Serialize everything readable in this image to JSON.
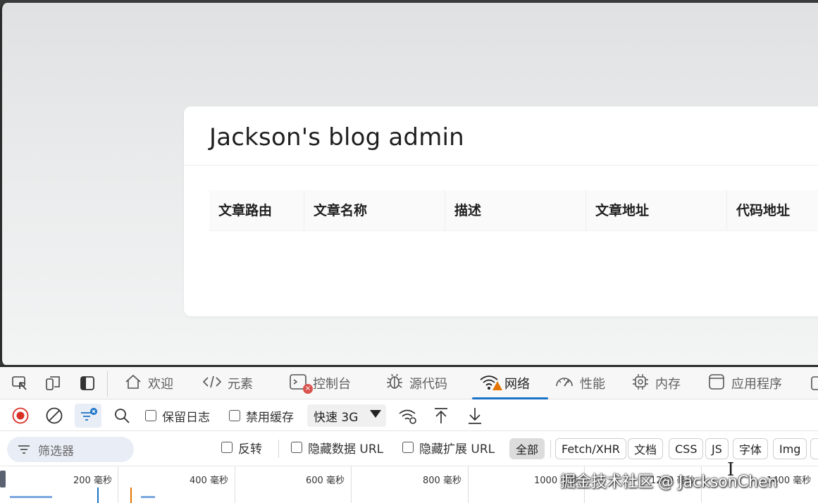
{
  "page": {
    "title": "Jackson's blog admin",
    "table_headers": [
      "文章路由",
      "文章名称",
      "描述",
      "文章地址",
      "代码地址"
    ]
  },
  "devtools": {
    "tabs": [
      {
        "label": "欢迎",
        "icon": "home-icon"
      },
      {
        "label": "元素",
        "icon": "code-icon"
      },
      {
        "label": "控制台",
        "icon": "console-icon"
      },
      {
        "label": "源代码",
        "icon": "bug-icon"
      },
      {
        "label": "网络",
        "icon": "wifi-warning-icon",
        "active": true
      },
      {
        "label": "性能",
        "icon": "gauge-icon"
      },
      {
        "label": "内存",
        "icon": "chip-icon"
      },
      {
        "label": "应用程序",
        "icon": "app-window-icon"
      }
    ],
    "toolbar": {
      "preserve_log": "保留日志",
      "disable_cache": "禁用缓存",
      "throttle": "快速 3G"
    },
    "filter": {
      "placeholder": "筛选器",
      "invert": "反转",
      "hide_data_urls": "隐藏数据 URL",
      "hide_extension_urls": "隐藏扩展 URL",
      "types": [
        "全部",
        "Fetch/XHR",
        "文档",
        "CSS",
        "JS",
        "字体",
        "Img"
      ]
    },
    "timeline": {
      "ticks": [
        "200 毫秒",
        "400 毫秒",
        "600 毫秒",
        "800 毫秒",
        "1000 毫秒",
        "1200 毫秒",
        "1400 毫秒"
      ]
    }
  },
  "watermark": "掘金技术社区 @ JacksonChen",
  "colors": {
    "accent": "#1a73c8",
    "record": "#d93025",
    "warning": "#e37400"
  }
}
